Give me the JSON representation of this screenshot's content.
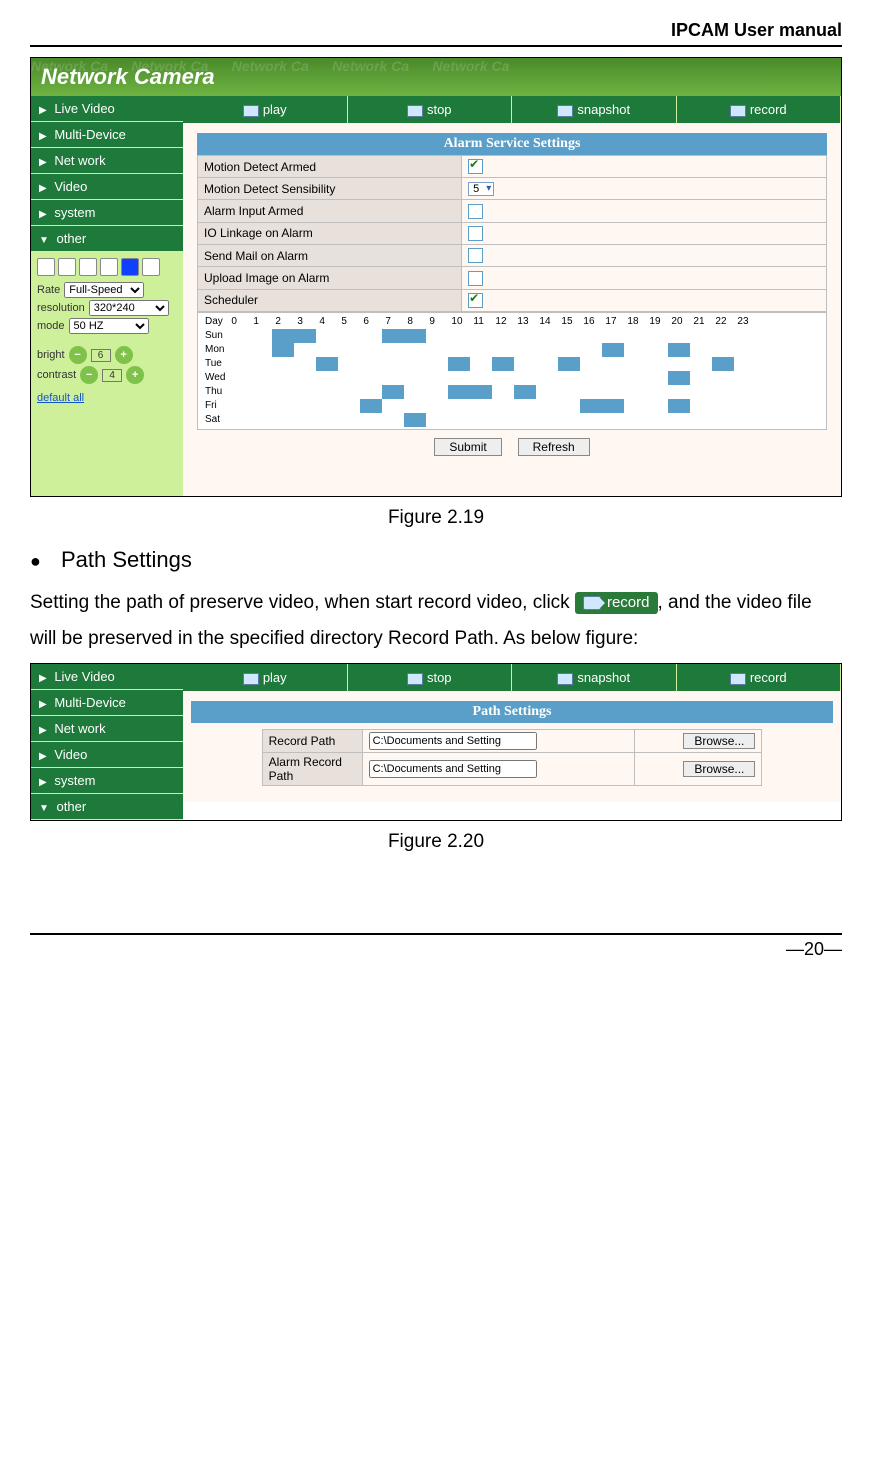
{
  "doc": {
    "header": "IPCAM User manual",
    "page_number": "—20—"
  },
  "figure1": {
    "caption": "Figure 2.19",
    "brand": "Network Camera",
    "top_buttons": [
      "play",
      "stop",
      "snapshot",
      "record"
    ],
    "nav": [
      {
        "label": "Live Video",
        "arrow": "▶"
      },
      {
        "label": "Multi-Device",
        "arrow": "▶"
      },
      {
        "label": "Net work",
        "arrow": "▶"
      },
      {
        "label": "Video",
        "arrow": "▶"
      },
      {
        "label": "system",
        "arrow": "▶"
      },
      {
        "label": "other",
        "arrow": "▼"
      }
    ],
    "side_controls": {
      "rate_label": "Rate",
      "rate_value": "Full-Speed",
      "resolution_label": "resolution",
      "resolution_value": "320*240",
      "mode_label": "mode",
      "mode_value": "50 HZ",
      "bright_label": "bright",
      "bright_value": "6",
      "contrast_label": "contrast",
      "contrast_value": "4",
      "default_all": "default all"
    },
    "panel_title": "Alarm Service Settings",
    "rows": [
      {
        "label": "Motion Detect Armed",
        "ctrl": "check_on"
      },
      {
        "label": "Motion Detect Sensibility",
        "ctrl": "select",
        "value": "5"
      },
      {
        "label": "Alarm Input Armed",
        "ctrl": "check_off"
      },
      {
        "label": "IO Linkage on Alarm",
        "ctrl": "check_off"
      },
      {
        "label": "Send Mail on Alarm",
        "ctrl": "check_off"
      },
      {
        "label": "Upload Image on Alarm",
        "ctrl": "check_off"
      },
      {
        "label": "Scheduler",
        "ctrl": "check_on"
      }
    ],
    "sched_cols": [
      "Day",
      "0",
      "1",
      "2",
      "3",
      "4",
      "5",
      "6",
      "7",
      "8",
      "9",
      "10",
      "11",
      "12",
      "13",
      "14",
      "15",
      "16",
      "17",
      "18",
      "19",
      "20",
      "21",
      "22",
      "23"
    ],
    "sched_rows": [
      "Sun",
      "Mon",
      "Tue",
      "Wed",
      "Thu",
      "Fri",
      "Sat"
    ],
    "sched_marks": {
      "Sun": [
        2,
        3,
        7,
        8
      ],
      "Mon": [
        2,
        17,
        20
      ],
      "Tue": [
        4,
        10,
        12,
        15,
        22
      ],
      "Wed": [
        20
      ],
      "Thu": [
        7,
        10,
        11,
        13
      ],
      "Fri": [
        6,
        16,
        17,
        20
      ],
      "Sat": [
        8
      ]
    },
    "submit": "Submit",
    "refresh": "Refresh"
  },
  "section": {
    "heading": "Path Settings",
    "para_before": "Setting the path of preserve video, when start record video, click",
    "record_chip": "record",
    "para_after": ", and the video file will be preserved in the specified directory Record Path. As below figure:"
  },
  "figure2": {
    "caption": "Figure 2.20",
    "top_buttons": [
      "play",
      "stop",
      "snapshot",
      "record"
    ],
    "nav": [
      {
        "label": "Live Video",
        "arrow": "▶"
      },
      {
        "label": "Multi-Device",
        "arrow": "▶"
      },
      {
        "label": "Net work",
        "arrow": "▶"
      },
      {
        "label": "Video",
        "arrow": "▶"
      },
      {
        "label": "system",
        "arrow": "▶"
      },
      {
        "label": "other",
        "arrow": "▼"
      }
    ],
    "panel_title": "Path Settings",
    "rows": [
      {
        "label": "Record Path",
        "value": "C:\\Documents and Setting",
        "btn": "Browse..."
      },
      {
        "label": "Alarm Record Path",
        "value": "C:\\Documents and Setting",
        "btn": "Browse..."
      }
    ]
  }
}
